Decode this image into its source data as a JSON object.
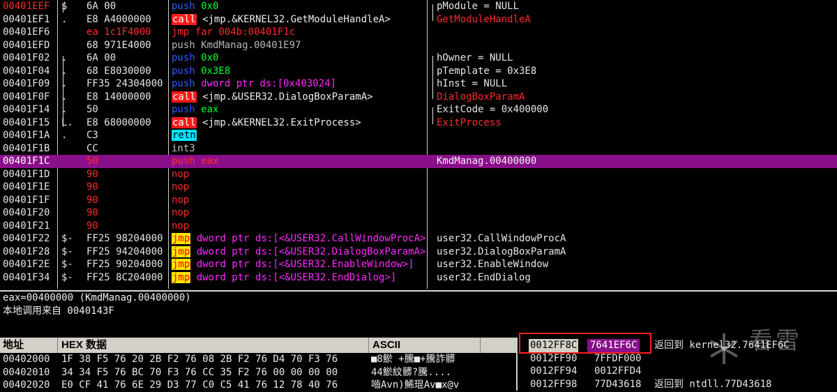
{
  "disasm": [
    {
      "addr": "00401EEF",
      "mark": "$",
      "hex": "6A 00",
      "ops": [
        {
          "t": "push",
          "c": "k-push"
        },
        {
          "t": " 0x0",
          "c": "op-green"
        }
      ],
      "comment": [
        {
          "t": "pModule = NULL",
          "c": ""
        }
      ],
      "addr_red": true
    },
    {
      "addr": "00401EF1",
      "mark": ".",
      "hex": "E8 A4000000",
      "ops": [
        {
          "t": "call",
          "c": "k-call"
        },
        {
          "t": " <jmp.&KERNEL32.GetModuleHandleA>",
          "c": "op-white"
        }
      ],
      "comment": [
        {
          "t": "GetModuleHandleA",
          "c": "cmt-red"
        }
      ]
    },
    {
      "addr": "00401EF6",
      "mark": "",
      "hex": "ea 1c1F4000",
      "hex_red": true,
      "ops": [
        {
          "t": "jmp far 004b:00401F1c",
          "c": "k-jmpfar"
        }
      ],
      "comment": []
    },
    {
      "addr": "00401EFD",
      "mark": "",
      "hex": "68 971E4000",
      "ops": [
        {
          "t": "push KmdManag.00401E97",
          "c": "k-gray"
        }
      ],
      "comment": []
    },
    {
      "addr": "00401F02",
      "mark": ".",
      "hex": "6A 00",
      "ops": [
        {
          "t": "push",
          "c": "k-push"
        },
        {
          "t": " 0x0",
          "c": "op-green"
        }
      ],
      "comment": [
        {
          "t": "hOwner = NULL",
          "c": ""
        }
      ]
    },
    {
      "addr": "00401F04",
      "mark": ".",
      "hex": "68 E8030000",
      "ops": [
        {
          "t": "push",
          "c": "k-push"
        },
        {
          "t": " 0x3E8",
          "c": "op-green"
        }
      ],
      "comment": [
        {
          "t": "pTemplate = 0x3E8",
          "c": ""
        }
      ]
    },
    {
      "addr": "00401F09",
      "mark": ".",
      "hex": "FF35 24304000",
      "ops": [
        {
          "t": "push",
          "c": "k-push"
        },
        {
          "t": " dword ptr ds:[0x403024]",
          "c": "op-mag"
        }
      ],
      "comment": [
        {
          "t": "hInst = NULL",
          "c": ""
        }
      ]
    },
    {
      "addr": "00401F0F",
      "mark": ".",
      "hex": "E8 14000000",
      "ops": [
        {
          "t": "call",
          "c": "k-call"
        },
        {
          "t": " <jmp.&USER32.DialogBoxParamA>",
          "c": "op-white"
        }
      ],
      "comment": [
        {
          "t": "DialogBoxParamA",
          "c": "cmt-red"
        }
      ]
    },
    {
      "addr": "00401F14",
      "mark": ".",
      "hex": "50",
      "ops": [
        {
          "t": "push",
          "c": "k-push"
        },
        {
          "t": " eax",
          "c": "op-green"
        }
      ],
      "comment": [
        {
          "t": "ExitCode = 0x400000",
          "c": ""
        }
      ]
    },
    {
      "addr": "00401F15",
      "mark": "L.",
      "hex": "E8 68000000",
      "ops": [
        {
          "t": "call",
          "c": "k-call"
        },
        {
          "t": " <jmp.&KERNEL32.ExitProcess>",
          "c": "op-white"
        }
      ],
      "comment": [
        {
          "t": "ExitProcess",
          "c": "cmt-red"
        }
      ]
    },
    {
      "addr": "00401F1A",
      "mark": ".",
      "hex": "C3",
      "ops": [
        {
          "t": "retn",
          "c": "k-retn"
        }
      ],
      "comment": []
    },
    {
      "addr": "00401F1B",
      "mark": "",
      "hex": "CC",
      "ops": [
        {
          "t": "int3",
          "c": "k-int"
        }
      ],
      "comment": []
    },
    {
      "addr": "00401F1C",
      "mark": "",
      "hex": "50",
      "ops": [
        {
          "t": "push eax",
          "c": ""
        }
      ],
      "comment": [
        {
          "t": "KmdManag.00400000",
          "c": ""
        }
      ],
      "selected": true
    },
    {
      "addr": "00401F1D",
      "mark": "",
      "hex": "90",
      "hex_red": true,
      "ops": [
        {
          "t": "nop",
          "c": "k-nop"
        }
      ],
      "comment": []
    },
    {
      "addr": "00401F1E",
      "mark": "",
      "hex": "90",
      "hex_red": true,
      "ops": [
        {
          "t": "nop",
          "c": "k-nop"
        }
      ],
      "comment": []
    },
    {
      "addr": "00401F1F",
      "mark": "",
      "hex": "90",
      "hex_red": true,
      "ops": [
        {
          "t": "nop",
          "c": "k-nop"
        }
      ],
      "comment": []
    },
    {
      "addr": "00401F20",
      "mark": "",
      "hex": "90",
      "hex_red": true,
      "ops": [
        {
          "t": "nop",
          "c": "k-nop"
        }
      ],
      "comment": []
    },
    {
      "addr": "00401F21",
      "mark": "",
      "hex": "90",
      "hex_red": true,
      "ops": [
        {
          "t": "nop",
          "c": "k-nop"
        }
      ],
      "comment": []
    },
    {
      "addr": "00401F22",
      "mark": "$-",
      "hex": "FF25 98204000",
      "ops": [
        {
          "t": "jmp",
          "c": "k-jmp"
        },
        {
          "t": " dword ptr ds:[<&USER32.CallWindowProcA>]",
          "c": "op-mag"
        }
      ],
      "comment": [
        {
          "t": "user32.CallWindowProcA",
          "c": ""
        }
      ]
    },
    {
      "addr": "00401F28",
      "mark": "$-",
      "hex": "FF25 94204000",
      "ops": [
        {
          "t": "jmp",
          "c": "k-jmp"
        },
        {
          "t": " dword ptr ds:[<&USER32.DialogBoxParamA>]",
          "c": "op-mag"
        }
      ],
      "comment": [
        {
          "t": "user32.DialogBoxParamA",
          "c": ""
        }
      ]
    },
    {
      "addr": "00401F2E",
      "mark": "$-",
      "hex": "FF25 90204000",
      "ops": [
        {
          "t": "jmp",
          "c": "k-jmp"
        },
        {
          "t": " dword ptr ds:[<&USER32.EnableWindow>]",
          "c": "op-mag"
        }
      ],
      "comment": [
        {
          "t": "user32.EnableWindow",
          "c": ""
        }
      ]
    },
    {
      "addr": "00401F34",
      "mark": "$-",
      "hex": "FF25 8C204000",
      "ops": [
        {
          "t": "jmp",
          "c": "k-jmp"
        },
        {
          "t": " dword ptr ds:[<&USER32.EndDialog>]",
          "c": "op-mag"
        }
      ],
      "comment": [
        {
          "t": "user32.EndDialog",
          "c": ""
        }
      ]
    }
  ],
  "info": {
    "line1": "eax=00400000 (KmdManag.00400000)",
    "line2": "本地调用来自 0040143F"
  },
  "dump": {
    "headers": {
      "addr": "地址",
      "hex": "HEX 数据",
      "ascii": "ASCII"
    },
    "rows": [
      {
        "addr": "00402000",
        "hex": "1F 38 F5 76 20 2B F2 76 08 2B F2 76 D4 70 F3 76",
        "ascii": "■8鯲 +騰■+騰詐髒"
      },
      {
        "addr": "00402010",
        "hex": "34 34 F5 76 BC 70 F3 76 CC 35 F2 76 00 00 00 00",
        "ascii": "44鯲紋髒?騰...."
      },
      {
        "addr": "00402020",
        "hex": "E0 CF 41 76 6E 29 D3 77 C0 C5 41 76 12 78 40 76",
        "ascii": "嚙Avn)鯑琨Av■x@v"
      }
    ]
  },
  "stack": [
    {
      "addr": "0012FF8C",
      "val": "7641EF6C",
      "cmt": "返回到 kernel32.7641EF6C",
      "top": true
    },
    {
      "addr": "0012FF90",
      "val": "7FFDF000",
      "cmt": ""
    },
    {
      "addr": "0012FF94",
      "val": "0012FFD4",
      "cmt": ""
    },
    {
      "addr": "0012FF98",
      "val": "77D43618",
      "cmt": "返回到 ntdll.77D43618"
    }
  ],
  "watermark": {
    "text": "看雪"
  },
  "colors": {
    "selection": "#8a0f8a",
    "call_bg": "#ff1a1a",
    "jmp_bg": "#ffe600",
    "retn_bg": "#00e5ff",
    "push": "#2c5cff",
    "highlight": "#ff2020"
  }
}
